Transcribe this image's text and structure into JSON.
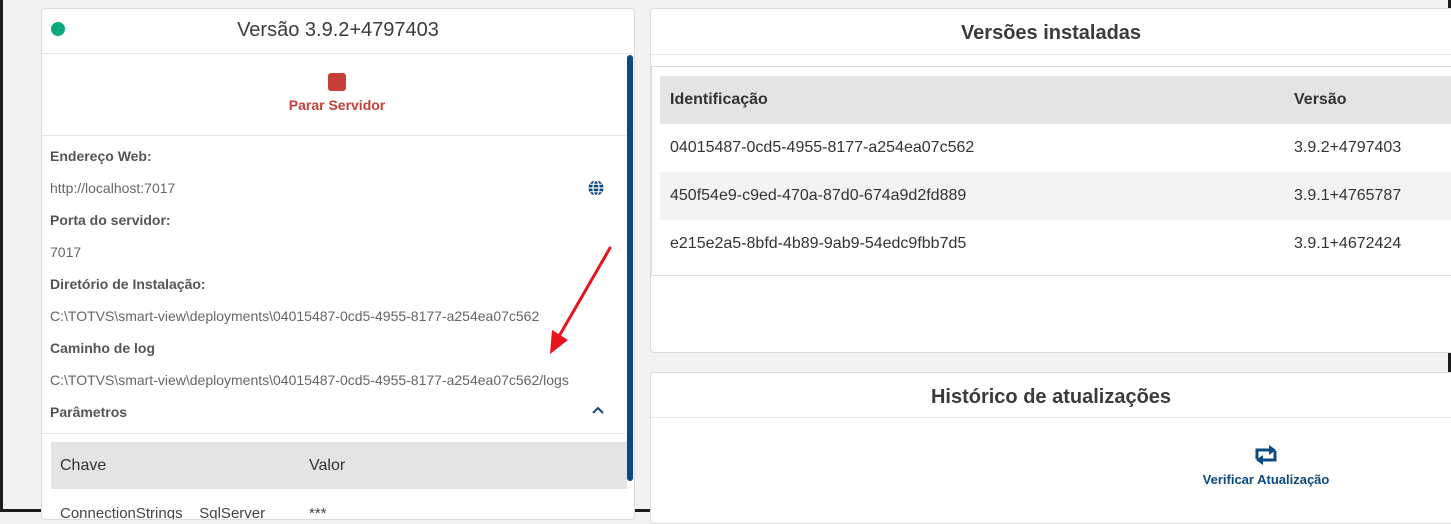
{
  "server": {
    "status_color": "#0aa97f",
    "version_title": "Versão 3.9.2+4797403",
    "stop_label": "Parar Servidor",
    "web_address_label": "Endereço Web:",
    "web_address_value": "http://localhost:7017",
    "port_label": "Porta do servidor:",
    "port_value": "7017",
    "install_dir_label": "Diretório de Instalação:",
    "install_dir_value": "C:\\TOTVS\\smart-view\\deployments\\04015487-0cd5-4955-8177-a254ea07c562",
    "log_path_label": "Caminho de log",
    "log_path_value": "C:\\TOTVS\\smart-view\\deployments\\04015487-0cd5-4955-8177-a254ea07c562/logs",
    "params_label": "Parâmetros",
    "params_table": {
      "headers": [
        "Chave",
        "Valor"
      ],
      "rows": [
        {
          "key": "ConnectionStrings__SqlServer",
          "value": "***"
        }
      ]
    }
  },
  "installed_versions": {
    "title": "Versões instaladas",
    "headers": [
      "Identificação",
      "Versão"
    ],
    "rows": [
      {
        "id": "04015487-0cd5-4955-8177-a254ea07c562",
        "version": "3.9.2+4797403"
      },
      {
        "id": "450f54e9-c9ed-470a-87d0-674a9d2fd889",
        "version": "3.9.1+4765787"
      },
      {
        "id": "e215e2a5-8bfd-4b89-9ab9-54edc9fbb7d5",
        "version": "3.9.1+4672424"
      }
    ]
  },
  "update_history": {
    "title": "Histórico de atualizações",
    "check_label": "Verificar Atualização"
  },
  "icons": {
    "status": "status-dot-icon",
    "stop": "stop-icon",
    "globe": "globe-icon",
    "chevron": "chevron-up-icon",
    "refresh": "refresh-icon"
  },
  "colors": {
    "accent": "#0b4a80",
    "danger": "#c6403a",
    "success": "#0aa97f",
    "annotation": "#e8141b"
  }
}
